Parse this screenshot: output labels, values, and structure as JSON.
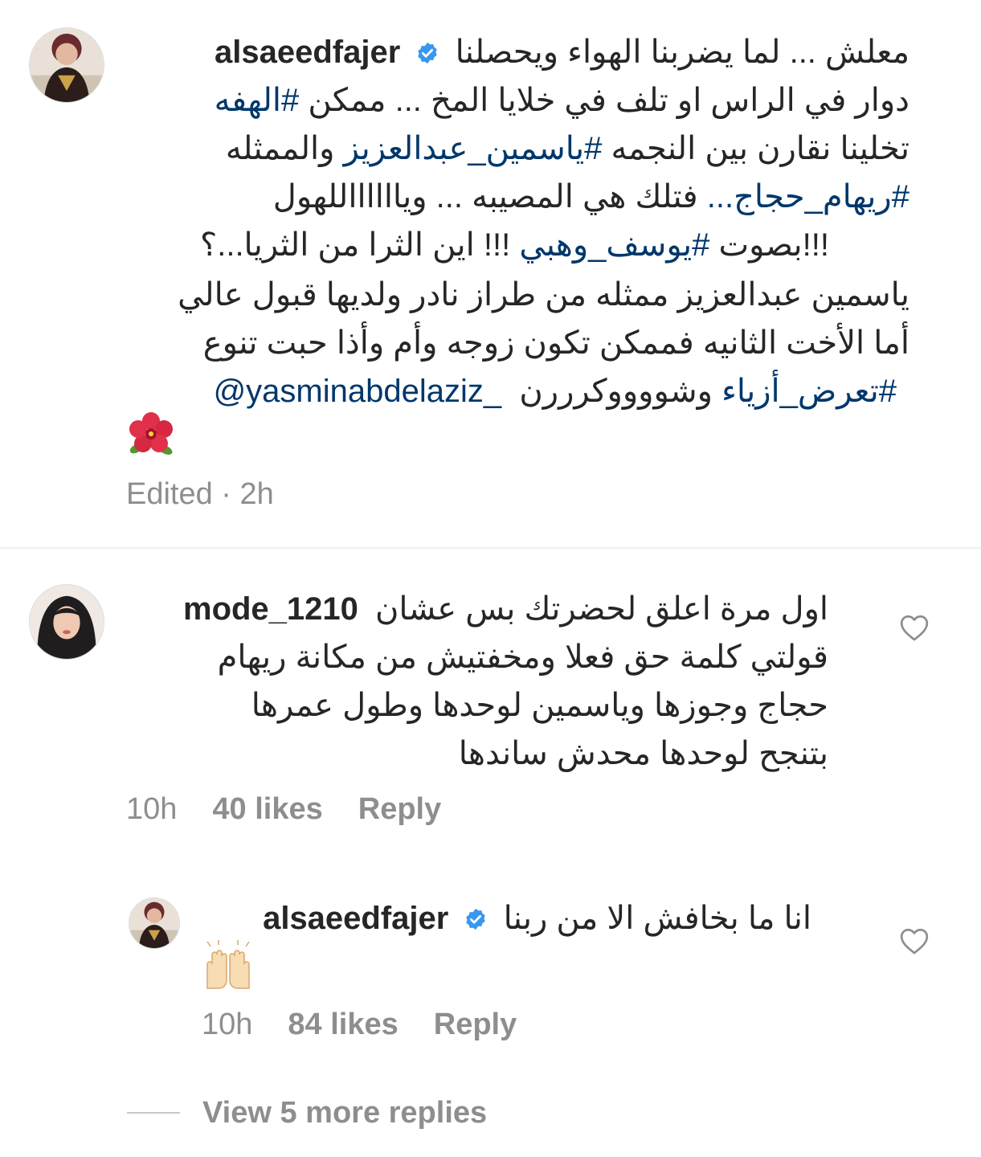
{
  "comments": [
    {
      "username": "alsaeedfajer",
      "verified": true,
      "lines": [
        "معلش ... لما يضربنا الهواء ويحصلنا",
        "دوار في الراس او تلف في خلايا المخ ... ممكن",
        "تخلينا نقارن بين النجمه",
        "والممثله",
        "فتلك هي المصيبه ... ويااااااللهول",
        "!!!بصوت",
        "!!! اين الثرا من الثريا...؟",
        "ياسمين عبدالعزيز ممثله من طراز نادر ولديها قبول عالي",
        "أما الأخت الثانيه فممكن تكون زوجه وأم وأذا حبت تنوع",
        "وشووووكرررن"
      ],
      "hashtags": {
        "h1": "#الهفه",
        "h2": "#ياسمين_عبدالعزيز",
        "h3": "#ريهام_حجاج...",
        "h4": "#يوسف_وهبي",
        "h5": "#تعرض_أزياء"
      },
      "mention": "@yasminabdelaziz_",
      "emoji": "hibiscus",
      "meta": "Edited · 2h"
    },
    {
      "username": "mode_1210",
      "verified": false,
      "lines": [
        "اول مرة اعلق لحضرتك بس عشان",
        "قولتي كلمة حق فعلا ومخفتيش من مكانة ريهام",
        "حجاج وجوزها وياسمين لوحدها وطول عمرها",
        "بتنجح لوحدها محدش ساندها"
      ],
      "time": "10h",
      "likes": "40 likes",
      "reply": "Reply",
      "like_icon": "heart-outline-icon"
    }
  ],
  "reply": {
    "username": "alsaeedfajer",
    "verified": true,
    "text": "انا ما بخافش الا من ربنا",
    "emoji": "raising-hands",
    "time": "10h",
    "likes": "84 likes",
    "reply_label": "Reply",
    "like_icon": "heart-outline-icon"
  },
  "view_more": "View 5 more replies",
  "colors": {
    "link": "#00376b",
    "meta": "#8e8e8e",
    "verified": "#3897f0",
    "divider": "#efefef"
  }
}
